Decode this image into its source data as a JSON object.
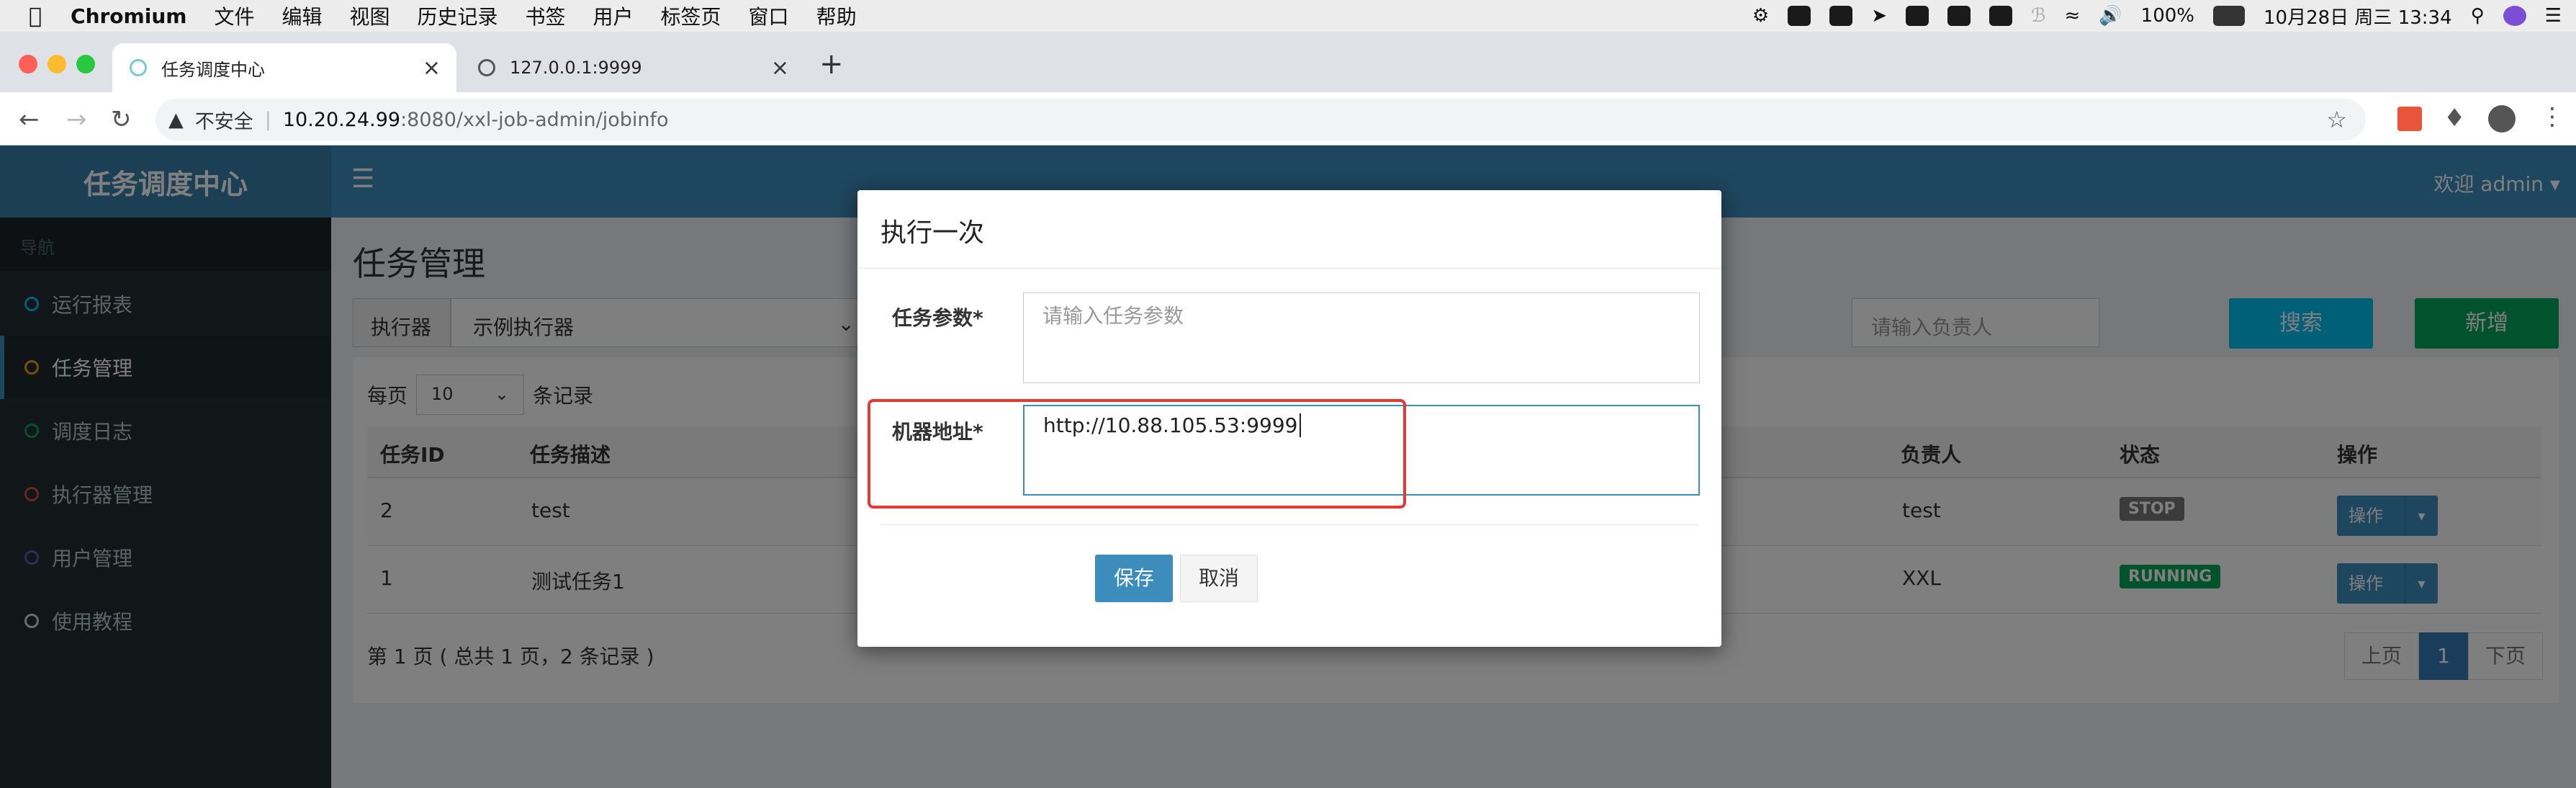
{
  "menubar": {
    "app_name": "Chromium",
    "items": [
      "文件",
      "编辑",
      "视图",
      "历史记录",
      "书签",
      "用户",
      "标签页",
      "窗口",
      "帮助"
    ],
    "battery": "100%",
    "datetime": "10月28日 周三 13:34"
  },
  "tabs": [
    {
      "title": "任务调度中心",
      "active": true
    },
    {
      "title": "127.0.0.1:9999",
      "active": false
    }
  ],
  "address": {
    "security": "不安全",
    "host": "10.20.24.99",
    "path": ":8080/xxl-job-admin/jobinfo"
  },
  "brand": "任务调度中心",
  "welcome": "欢迎 admin",
  "nav_section": "导航",
  "sidebar": [
    {
      "label": "运行报表",
      "color": "#00c0ef"
    },
    {
      "label": "任务管理",
      "color": "#f39c12",
      "active": true
    },
    {
      "label": "调度日志",
      "color": "#00a65a"
    },
    {
      "label": "执行器管理",
      "color": "#dd4b39"
    },
    {
      "label": "用户管理",
      "color": "#605ca8"
    },
    {
      "label": "使用教程",
      "color": "#d2d6de"
    }
  ],
  "page_title": "任务管理",
  "filter": {
    "executor_label": "执行器",
    "executor_value": "示例执行器",
    "owner_placeholder": "请输入负责人",
    "search_label": "搜索",
    "add_label": "新增"
  },
  "paging": {
    "per_page_prefix": "每页",
    "per_page_value": "10",
    "per_page_suffix": "条记录"
  },
  "table": {
    "headers": [
      "任务ID",
      "任务描述",
      "负责人",
      "状态",
      "操作"
    ],
    "rows": [
      {
        "id": "2",
        "desc": "test",
        "owner": "test",
        "status": "STOP",
        "action": "操作"
      },
      {
        "id": "1",
        "desc": "测试任务1",
        "owner": "XXL",
        "status": "RUNNING",
        "action": "操作"
      }
    ]
  },
  "footer_info": "第 1 页 ( 总共 1 页，2 条记录 )",
  "pagination": {
    "prev": "上页",
    "current": "1",
    "next": "下页"
  },
  "modal": {
    "title": "执行一次",
    "param_label": "任务参数*",
    "param_placeholder": "请输入任务参数",
    "addr_label": "机器地址*",
    "addr_value": "http://10.88.105.53:9999",
    "save": "保存",
    "cancel": "取消"
  },
  "colors": {
    "accent": "#3c8dbc",
    "highlight": "#e53935",
    "stop": "#777777",
    "running": "#00a65a"
  }
}
